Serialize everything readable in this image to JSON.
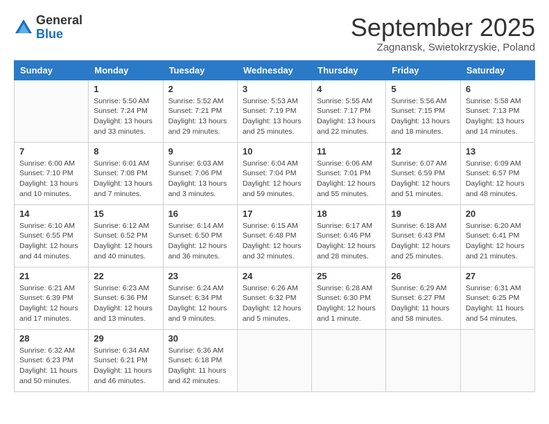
{
  "header": {
    "logo": {
      "general": "General",
      "blue": "Blue"
    },
    "month": "September 2025",
    "location": "Zagnansk, Swietokrzyskie, Poland"
  },
  "weekdays": [
    "Sunday",
    "Monday",
    "Tuesday",
    "Wednesday",
    "Thursday",
    "Friday",
    "Saturday"
  ],
  "weeks": [
    [
      {
        "day": "",
        "sunrise": "",
        "sunset": "",
        "daylight": ""
      },
      {
        "day": "1",
        "sunrise": "Sunrise: 5:50 AM",
        "sunset": "Sunset: 7:24 PM",
        "daylight": "Daylight: 13 hours and 33 minutes."
      },
      {
        "day": "2",
        "sunrise": "Sunrise: 5:52 AM",
        "sunset": "Sunset: 7:21 PM",
        "daylight": "Daylight: 13 hours and 29 minutes."
      },
      {
        "day": "3",
        "sunrise": "Sunrise: 5:53 AM",
        "sunset": "Sunset: 7:19 PM",
        "daylight": "Daylight: 13 hours and 25 minutes."
      },
      {
        "day": "4",
        "sunrise": "Sunrise: 5:55 AM",
        "sunset": "Sunset: 7:17 PM",
        "daylight": "Daylight: 13 hours and 22 minutes."
      },
      {
        "day": "5",
        "sunrise": "Sunrise: 5:56 AM",
        "sunset": "Sunset: 7:15 PM",
        "daylight": "Daylight: 13 hours and 18 minutes."
      },
      {
        "day": "6",
        "sunrise": "Sunrise: 5:58 AM",
        "sunset": "Sunset: 7:13 PM",
        "daylight": "Daylight: 13 hours and 14 minutes."
      }
    ],
    [
      {
        "day": "7",
        "sunrise": "Sunrise: 6:00 AM",
        "sunset": "Sunset: 7:10 PM",
        "daylight": "Daylight: 13 hours and 10 minutes."
      },
      {
        "day": "8",
        "sunrise": "Sunrise: 6:01 AM",
        "sunset": "Sunset: 7:08 PM",
        "daylight": "Daylight: 13 hours and 7 minutes."
      },
      {
        "day": "9",
        "sunrise": "Sunrise: 6:03 AM",
        "sunset": "Sunset: 7:06 PM",
        "daylight": "Daylight: 13 hours and 3 minutes."
      },
      {
        "day": "10",
        "sunrise": "Sunrise: 6:04 AM",
        "sunset": "Sunset: 7:04 PM",
        "daylight": "Daylight: 12 hours and 59 minutes."
      },
      {
        "day": "11",
        "sunrise": "Sunrise: 6:06 AM",
        "sunset": "Sunset: 7:01 PM",
        "daylight": "Daylight: 12 hours and 55 minutes."
      },
      {
        "day": "12",
        "sunrise": "Sunrise: 6:07 AM",
        "sunset": "Sunset: 6:59 PM",
        "daylight": "Daylight: 12 hours and 51 minutes."
      },
      {
        "day": "13",
        "sunrise": "Sunrise: 6:09 AM",
        "sunset": "Sunset: 6:57 PM",
        "daylight": "Daylight: 12 hours and 48 minutes."
      }
    ],
    [
      {
        "day": "14",
        "sunrise": "Sunrise: 6:10 AM",
        "sunset": "Sunset: 6:55 PM",
        "daylight": "Daylight: 12 hours and 44 minutes."
      },
      {
        "day": "15",
        "sunrise": "Sunrise: 6:12 AM",
        "sunset": "Sunset: 6:52 PM",
        "daylight": "Daylight: 12 hours and 40 minutes."
      },
      {
        "day": "16",
        "sunrise": "Sunrise: 6:14 AM",
        "sunset": "Sunset: 6:50 PM",
        "daylight": "Daylight: 12 hours and 36 minutes."
      },
      {
        "day": "17",
        "sunrise": "Sunrise: 6:15 AM",
        "sunset": "Sunset: 6:48 PM",
        "daylight": "Daylight: 12 hours and 32 minutes."
      },
      {
        "day": "18",
        "sunrise": "Sunrise: 6:17 AM",
        "sunset": "Sunset: 6:46 PM",
        "daylight": "Daylight: 12 hours and 28 minutes."
      },
      {
        "day": "19",
        "sunrise": "Sunrise: 6:18 AM",
        "sunset": "Sunset: 6:43 PM",
        "daylight": "Daylight: 12 hours and 25 minutes."
      },
      {
        "day": "20",
        "sunrise": "Sunrise: 6:20 AM",
        "sunset": "Sunset: 6:41 PM",
        "daylight": "Daylight: 12 hours and 21 minutes."
      }
    ],
    [
      {
        "day": "21",
        "sunrise": "Sunrise: 6:21 AM",
        "sunset": "Sunset: 6:39 PM",
        "daylight": "Daylight: 12 hours and 17 minutes."
      },
      {
        "day": "22",
        "sunrise": "Sunrise: 6:23 AM",
        "sunset": "Sunset: 6:36 PM",
        "daylight": "Daylight: 12 hours and 13 minutes."
      },
      {
        "day": "23",
        "sunrise": "Sunrise: 6:24 AM",
        "sunset": "Sunset: 6:34 PM",
        "daylight": "Daylight: 12 hours and 9 minutes."
      },
      {
        "day": "24",
        "sunrise": "Sunrise: 6:26 AM",
        "sunset": "Sunset: 6:32 PM",
        "daylight": "Daylight: 12 hours and 5 minutes."
      },
      {
        "day": "25",
        "sunrise": "Sunrise: 6:28 AM",
        "sunset": "Sunset: 6:30 PM",
        "daylight": "Daylight: 12 hours and 1 minute."
      },
      {
        "day": "26",
        "sunrise": "Sunrise: 6:29 AM",
        "sunset": "Sunset: 6:27 PM",
        "daylight": "Daylight: 11 hours and 58 minutes."
      },
      {
        "day": "27",
        "sunrise": "Sunrise: 6:31 AM",
        "sunset": "Sunset: 6:25 PM",
        "daylight": "Daylight: 11 hours and 54 minutes."
      }
    ],
    [
      {
        "day": "28",
        "sunrise": "Sunrise: 6:32 AM",
        "sunset": "Sunset: 6:23 PM",
        "daylight": "Daylight: 11 hours and 50 minutes."
      },
      {
        "day": "29",
        "sunrise": "Sunrise: 6:34 AM",
        "sunset": "Sunset: 6:21 PM",
        "daylight": "Daylight: 11 hours and 46 minutes."
      },
      {
        "day": "30",
        "sunrise": "Sunrise: 6:36 AM",
        "sunset": "Sunset: 6:18 PM",
        "daylight": "Daylight: 11 hours and 42 minutes."
      },
      {
        "day": "",
        "sunrise": "",
        "sunset": "",
        "daylight": ""
      },
      {
        "day": "",
        "sunrise": "",
        "sunset": "",
        "daylight": ""
      },
      {
        "day": "",
        "sunrise": "",
        "sunset": "",
        "daylight": ""
      },
      {
        "day": "",
        "sunrise": "",
        "sunset": "",
        "daylight": ""
      }
    ]
  ]
}
